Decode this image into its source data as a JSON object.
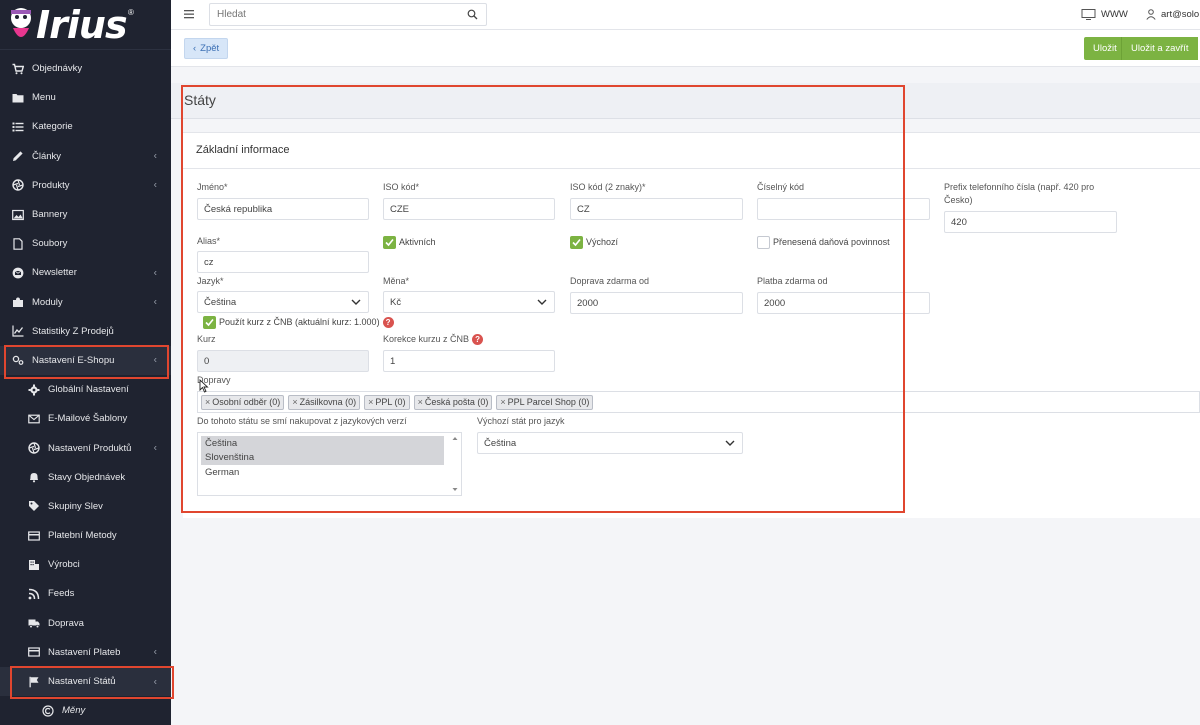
{
  "brand": {
    "logo_text": "Irius",
    "logo_reg": "®"
  },
  "sidebar": {
    "items": [
      {
        "label": "Objednávky",
        "icon": "cart-icon",
        "chevron": false
      },
      {
        "label": "Menu",
        "icon": "folder-icon",
        "chevron": false
      },
      {
        "label": "Kategorie",
        "icon": "list-icon",
        "chevron": false
      },
      {
        "label": "Články",
        "icon": "pencil-icon",
        "chevron": true
      },
      {
        "label": "Produkty",
        "icon": "aperture-icon",
        "chevron": true
      },
      {
        "label": "Bannery",
        "icon": "image-icon",
        "chevron": false
      },
      {
        "label": "Soubory",
        "icon": "file-icon",
        "chevron": false
      },
      {
        "label": "Newsletter",
        "icon": "envelope-circle-icon",
        "chevron": true
      },
      {
        "label": "Moduly",
        "icon": "puzzle-icon",
        "chevron": true
      },
      {
        "label": "Statistiky Z Prodejů",
        "icon": "chart-line-icon",
        "chevron": false
      },
      {
        "label": "Nastavení E-Shopu",
        "icon": "cogs-icon",
        "chevron": true
      }
    ],
    "subitems": [
      {
        "label": "Globální Nastavení",
        "icon": "gear-icon",
        "chevron": false
      },
      {
        "label": "E-Mailové Šablony",
        "icon": "mail-icon",
        "chevron": false
      },
      {
        "label": "Nastavení Produktů",
        "icon": "aperture-icon",
        "chevron": true
      },
      {
        "label": "Stavy Objednávek",
        "icon": "bell-icon",
        "chevron": false
      },
      {
        "label": "Skupiny Slev",
        "icon": "tag-icon",
        "chevron": false
      },
      {
        "label": "Platební Metody",
        "icon": "credit-card-icon",
        "chevron": false
      },
      {
        "label": "Výrobci",
        "icon": "building-icon",
        "chevron": false
      },
      {
        "label": "Feeds",
        "icon": "rss-icon",
        "chevron": false
      },
      {
        "label": "Doprava",
        "icon": "truck-icon",
        "chevron": false
      },
      {
        "label": "Nastavení Plateb",
        "icon": "credit-card-icon",
        "chevron": true
      },
      {
        "label": "Nastavení Států",
        "icon": "flag-icon",
        "chevron": true
      }
    ],
    "subsub": {
      "label": "Měny",
      "icon": "copyright-icon"
    }
  },
  "topbar": {
    "search_placeholder": "Hledat",
    "www_label": "WWW",
    "user_label": "art@solo"
  },
  "actions": {
    "back_label": "Zpět",
    "save_label": "Uložit",
    "save_close_label": "Uložit a zavřít"
  },
  "page": {
    "title": "Státy"
  },
  "card": {
    "title": "Základní informace"
  },
  "form": {
    "name_label": "Jméno*",
    "name_value": "Česká republika",
    "iso_label": "ISO kód*",
    "iso_value": "CZE",
    "iso2_label": "ISO kód (2 znaky)*",
    "iso2_value": "CZ",
    "numcode_label": "Číselný kód",
    "numcode_value": "",
    "prefix_label": "Prefix telefonního čísla (např. 420 pro Česko)",
    "prefix_value": "420",
    "alias_label": "Alias*",
    "alias_value": "cz",
    "active_label": "Aktivních",
    "active_checked": true,
    "default_label": "Výchozí",
    "default_checked": true,
    "vat_label": "Přenesená daňová povinnost",
    "vat_checked": false,
    "lang_label": "Jazyk*",
    "lang_value": "Čeština",
    "currency_label": "Měna*",
    "currency_value": "Kč",
    "free_ship_label": "Doprava zdarma od",
    "free_ship_value": "2000",
    "free_pay_label": "Platba zdarma od",
    "free_pay_value": "2000",
    "cnb_label": "Použít kurz z ČNB (aktuální kurz: 1.000)",
    "cnb_checked": true,
    "rate_label": "Kurz",
    "rate_value": "0",
    "rate_corr_label": "Korekce kurzu z ČNB",
    "rate_corr_value": "1",
    "shipping_label": "Dopravy",
    "shipping_tags": [
      "Osobní odběr (0)",
      "Zásilkovna (0)",
      "PPL (0)",
      "Česká pošta (0)",
      "PPL Parcel Shop (0)"
    ],
    "langs_allowed_label": "Do tohoto státu se smí nakupovat z jazykových verzí",
    "langs_allowed": [
      {
        "label": "Čeština",
        "selected": true
      },
      {
        "label": "Slovenština",
        "selected": true
      },
      {
        "label": "German",
        "selected": false
      }
    ],
    "default_state_label": "Výchozí stát pro jazyk",
    "default_state_value": "Čeština"
  },
  "colors": {
    "sidebar_bg": "#1f2330",
    "accent_green": "#7cb342",
    "highlight_red": "#e0462f"
  }
}
